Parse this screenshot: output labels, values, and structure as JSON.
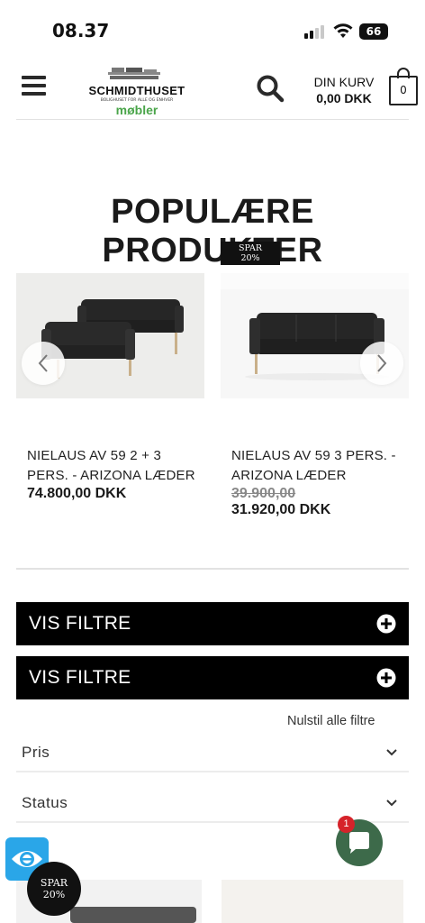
{
  "status_bar": {
    "time": "08.37",
    "battery": "66"
  },
  "header": {
    "logo_name": "SCHMIDTHUSET",
    "logo_tagline": "BOLIGHUSET FOR ALLE OG ENHVER",
    "logo_sub": "møbler",
    "cart_label": "DIN KURV",
    "cart_total": "0,00 DKK",
    "cart_count": "0"
  },
  "section_title": "POPULÆRE PRODUKTER",
  "products": [
    {
      "title_line1": "NIELAUS AV 59 2 + 3",
      "title_line2": "PERS. - ARIZONA LÆDER",
      "price": "74.800,00 DKK"
    },
    {
      "title_line1": "NIELAUS AV 59 3 PERS. -",
      "title_line2": "ARIZONA LÆDER",
      "price_old": "39.900,00",
      "price": "31.920,00 DKK",
      "badge_line1": "SPAR",
      "badge_line2": "20%"
    }
  ],
  "filters": {
    "toggle_label_1": "VIS FILTRE",
    "toggle_label_2": "VIS FILTRE",
    "reset_label": "Nulstil alle filtre"
  },
  "accordions": {
    "price": "Pris",
    "status": "Status"
  },
  "chat": {
    "badge": "1"
  },
  "bottom_badge": {
    "line1": "SPAR",
    "line2": "20%"
  },
  "colors": {
    "accent_green": "#4aa54a",
    "chat_green": "#3d6a4a",
    "a11y_blue": "#2aa6e8",
    "badge_red": "#d6232a"
  }
}
